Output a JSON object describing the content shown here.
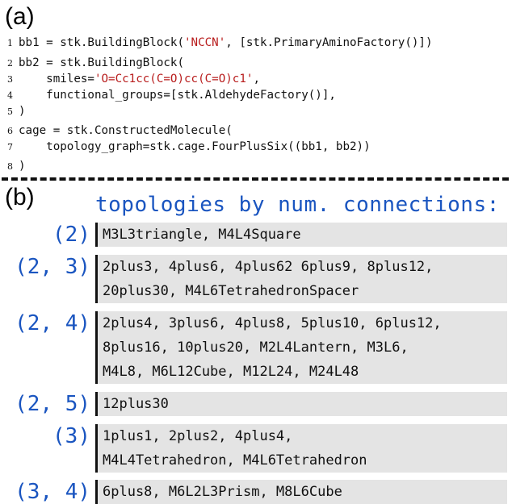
{
  "panel_a_label": "(a)",
  "panel_b_label": "(b)",
  "code": {
    "lines": [
      {
        "num": "1",
        "parts": [
          {
            "text": "bb1 = stk.BuildingBlock(",
            "str": false
          },
          {
            "text": "'NCCN'",
            "str": true
          },
          {
            "text": ", [stk.PrimaryAminoFactory()])",
            "str": false
          }
        ]
      },
      {
        "num": "2",
        "parts": [
          {
            "text": "bb2 = stk.BuildingBlock(",
            "str": false
          }
        ]
      },
      {
        "num": "3",
        "parts": [
          {
            "text": "    smiles=",
            "str": false
          },
          {
            "text": "'O=Cc1cc(C=O)cc(C=O)c1'",
            "str": true
          },
          {
            "text": ",",
            "str": false
          }
        ]
      },
      {
        "num": "4",
        "parts": [
          {
            "text": "    functional_groups=[stk.AldehydeFactory()],",
            "str": false
          }
        ]
      },
      {
        "num": "5",
        "parts": [
          {
            "text": ")",
            "str": false
          }
        ]
      },
      {
        "num": "6",
        "parts": [
          {
            "text": "cage = stk.ConstructedMolecule(",
            "str": false
          }
        ]
      },
      {
        "num": "7",
        "parts": [
          {
            "text": "    topology_graph=stk.cage.FourPlusSix((bb1, bb2))",
            "str": false
          }
        ]
      },
      {
        "num": "8",
        "parts": [
          {
            "text": ")",
            "str": false
          }
        ]
      }
    ]
  },
  "heading": "topologies by num. connections:",
  "groups": [
    {
      "tag": "(2)",
      "lines": [
        "M3L3triangle, M4L4Square"
      ]
    },
    {
      "tag": "(2, 3)",
      "lines": [
        "2plus3, 4plus6, 4plus62 6plus9, 8plus12,",
        "20plus30, M4L6TetrahedronSpacer"
      ]
    },
    {
      "tag": "(2, 4)",
      "lines": [
        "2plus4, 3plus6, 4plus8, 5plus10, 6plus12,",
        "8plus16, 10plus20, M2L4Lantern, M3L6,",
        "M4L8, M6L12Cube, M12L24, M24L48"
      ]
    },
    {
      "tag": "(2, 5)",
      "lines": [
        "12plus30"
      ]
    },
    {
      "tag": "(3)",
      "lines": [
        "1plus1, 2plus2, 4plus4,",
        "M4L4Tetrahedron, M4L6Tetrahedron"
      ]
    },
    {
      "tag": "(3, 4)",
      "lines": [
        "6plus8, M6L2L3Prism, M8L6Cube"
      ]
    }
  ]
}
